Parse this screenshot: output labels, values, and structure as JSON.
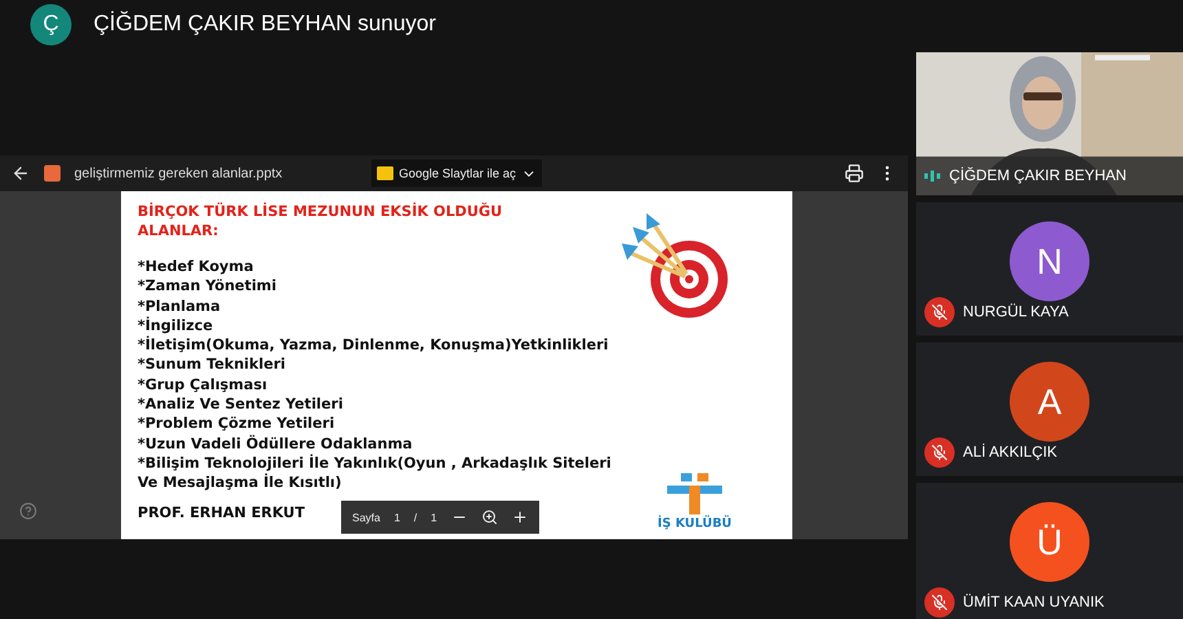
{
  "presenter_banner": {
    "avatar_letter": "Ç",
    "text": "ÇİĞDEM ÇAKIR BEYHAN sunuyor"
  },
  "viewer": {
    "file_name": "geliştirmemiz gereken alanlar.pptx",
    "open_with": "Google Slaytlar ile aç",
    "slide": {
      "title": "BİRÇOK TÜRK LİSE MEZUNUN EKSİK OLDUĞU ALANLAR:",
      "items": [
        "*Hedef Koyma",
        "*Zaman Yönetimi",
        "*Planlama",
        "*İngilizce",
        "*İletişim(Okuma, Yazma, Dinlenme, Konuşma)Yetkinlikleri",
        "*Sunum Teknikleri",
        "*Grup Çalışması",
        "*Analiz Ve Sentez Yetileri",
        "*Problem Çözme Yetileri",
        "*Uzun Vadeli Ödüllere Odaklanma",
        "*Bilişim Teknolojileri İle Yakınlık(Oyun , Arkadaşlık Siteleri Ve Mesajlaşma İle Kısıtlı)"
      ],
      "footer": "PROF. ERHAN ERKUT",
      "logo_text": "İŞ KULÜBÜ"
    },
    "page_bar": {
      "label": "Sayfa",
      "current": "1",
      "separator": "/",
      "total": "1"
    }
  },
  "participants": [
    {
      "name": "ÇİĞDEM ÇAKIR BEYHAN",
      "kind": "video",
      "muted": false,
      "speaking": true
    },
    {
      "name": "NURGÜL KAYA",
      "kind": "avatar",
      "letter": "N",
      "color": "#8e5ad0",
      "muted": true
    },
    {
      "name": "ALİ AKKILÇIK",
      "kind": "avatar",
      "letter": "A",
      "color": "#d2461c",
      "muted": true
    },
    {
      "name": "ÜMİT KAAN UYANIK",
      "kind": "avatar",
      "letter": "Ü",
      "color": "#f4511e",
      "muted": true
    }
  ]
}
